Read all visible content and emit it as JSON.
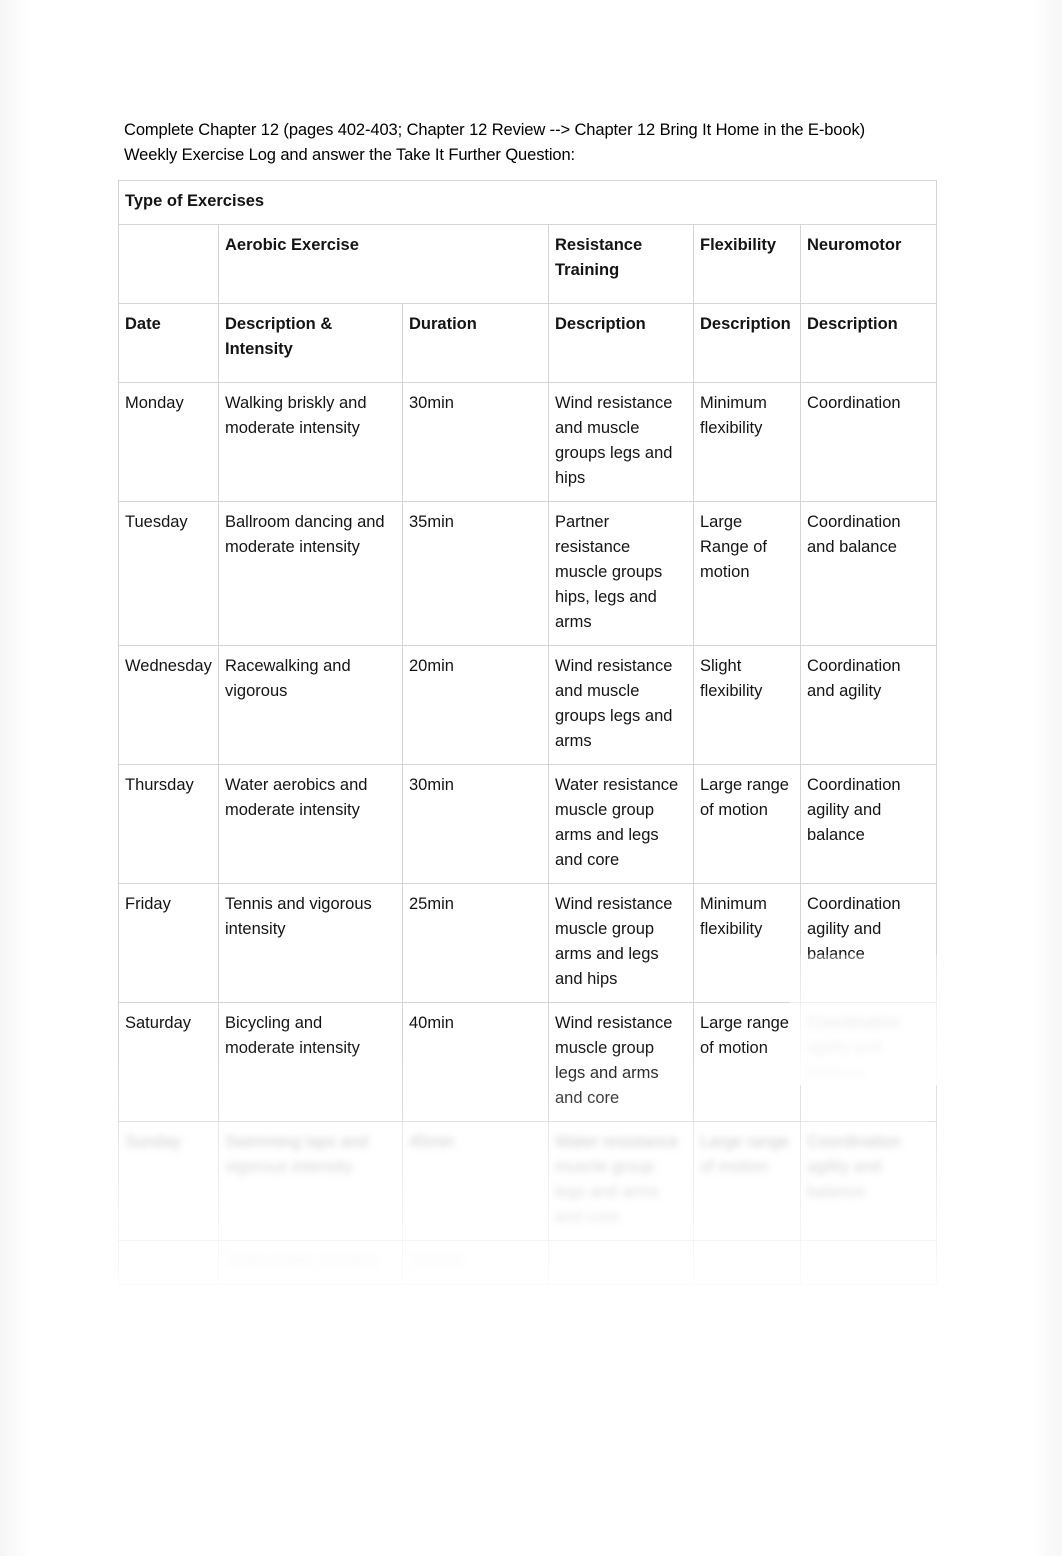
{
  "document": {
    "intro_lines": [
      "Complete Chapter 12 (pages 402-403; Chapter 12 Review --> Chapter 12 Bring It Home in the E-book)",
      "Weekly Exercise Log and answer the Take It Further Question:"
    ]
  },
  "table": {
    "title": "Type of Exercises",
    "group_headers": {
      "blank": "",
      "aerobic": "Aerobic Exercise",
      "resistance": "Resistance Training",
      "flexibility": "Flexibility",
      "neuromotor": "Neuromotor"
    },
    "column_headers": {
      "date": "Date",
      "description_intensity": "Description & Intensity",
      "duration": "Duration",
      "resistance_description": "Description",
      "flexibility_description": "Description",
      "neuromotor_description": "Description"
    },
    "rows": [
      {
        "date": "Monday",
        "description": " Walking briskly and moderate intensity",
        "duration": "30min",
        "resistance": " Wind resistance and muscle groups legs and hips",
        "flexibility": " Minimum flexibility",
        "neuromotor": " Coordination"
      },
      {
        "date": "Tuesday",
        "description": " Ballroom dancing and moderate intensity",
        "duration": "35min",
        "resistance": " Partner resistance muscle groups hips, legs and arms",
        "flexibility": " Large Range of motion",
        "neuromotor": " Coordination and balance"
      },
      {
        "date": "Wednesday",
        "description": "Racewalking and vigorous",
        "duration": "20min",
        "resistance": " Wind resistance and muscle groups legs and arms",
        "flexibility": " Slight flexibility",
        "neuromotor": " Coordination and agility"
      },
      {
        "date": "Thursday",
        "description": " Water aerobics and moderate intensity",
        "duration": "30min",
        "resistance": " Water resistance muscle group arms and legs and core",
        "flexibility": "Large range of motion",
        "neuromotor": " Coordination agility and balance"
      },
      {
        "date": "Friday",
        "description": " Tennis and vigorous intensity",
        "duration": "25min",
        "resistance": " Wind resistance muscle group arms and legs and hips",
        "flexibility": " Minimum flexibility",
        "neuromotor": " Coordination agility and balance"
      },
      {
        "date": "Saturday",
        "description": " Bicycling and moderate intensity",
        "duration": "40min",
        "resistance": " Wind resistance muscle group legs and arms and core",
        "flexibility": " Large range of motion",
        "neuromotor": " Coordination agility and balance"
      },
      {
        "date": "Sunday",
        "description": "Swimming laps and vigorous intensity",
        "duration": "45min",
        "resistance": "Water resistance muscle group legs and arms and core",
        "flexibility": "Large range of motion",
        "neuromotor": "Coordination agility and balance"
      },
      {
        "date": "",
        "description": "Total weekly minutes",
        "duration": "225min",
        "resistance": "",
        "flexibility": "",
        "neuromotor": ""
      }
    ]
  }
}
